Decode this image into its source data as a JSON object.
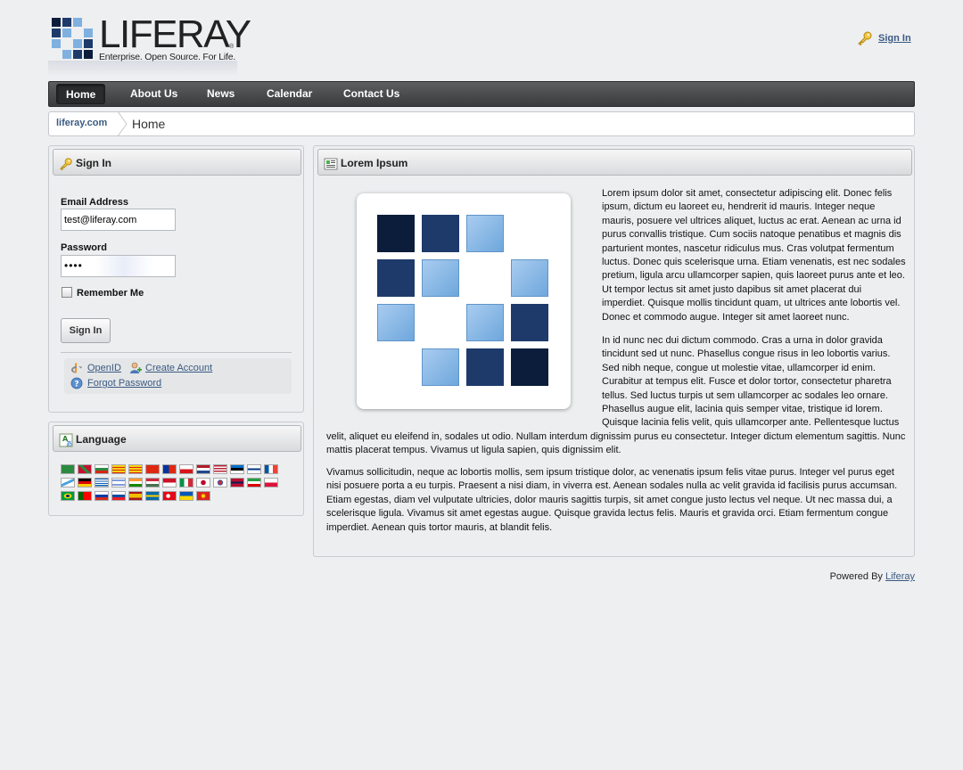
{
  "header": {
    "logo_text": "LIFERAY",
    "logo_reg": "®",
    "logo_tagline": "Enterprise. Open Source. For Life.",
    "sign_in_link": "Sign In"
  },
  "nav": {
    "items": [
      "Home",
      "About Us",
      "News",
      "Calendar",
      "Contact Us"
    ],
    "selected": "Home"
  },
  "breadcrumb": {
    "site": "liferay.com",
    "page": "Home"
  },
  "signin_portlet": {
    "title": "Sign In",
    "email_label": "Email Address",
    "email_value": "test@liferay.com",
    "password_label": "Password",
    "password_value": "••••",
    "remember_label": "Remember Me",
    "remember_checked": false,
    "submit_label": "Sign In",
    "openid_link": "OpenID",
    "create_account_link": "Create Account",
    "forgot_password_link": "Forgot Password"
  },
  "language_portlet": {
    "title": "Language",
    "flags": [
      "saudi-arabia-flag",
      "basque-flag",
      "bulgaria-flag",
      "catalonia-flag",
      "catalonia-flag",
      "china-flag",
      "taiwan-flag",
      "czech-flag",
      "netherlands-flag",
      "usa-flag",
      "estonia-flag",
      "finland-flag",
      "france-flag",
      "galicia-flag",
      "germany-flag",
      "greece-flag",
      "israel-flag",
      "india-flag",
      "hungary-flag",
      "indonesia-flag",
      "italy-flag",
      "japan-flag",
      "korea-flag",
      "norway-flag",
      "iran-flag",
      "poland-flag",
      "brazil-flag",
      "portugal-flag",
      "russia-flag",
      "slovakia-flag",
      "spain-flag",
      "sweden-flag",
      "turkey-flag",
      "ukraine-flag",
      "vietnam-flag"
    ]
  },
  "content_portlet": {
    "title": "Lorem Ipsum",
    "paragraphs": [
      "Lorem ipsum dolor sit amet, consectetur adipiscing elit. Donec felis ipsum, dictum eu laoreet eu, hendrerit id mauris. Integer neque mauris, posuere vel ultrices aliquet, luctus ac erat. Aenean ac urna id purus convallis tristique. Cum sociis natoque penatibus et magnis dis parturient montes, nascetur ridiculus mus. Cras volutpat fermentum luctus. Donec quis scelerisque urna. Etiam venenatis, est nec sodales pretium, ligula arcu ullamcorper sapien, quis laoreet purus ante et leo. Ut tempor lectus sit amet justo dapibus sit amet placerat dui imperdiet. Quisque mollis tincidunt quam, ut ultrices ante lobortis vel. Donec et commodo augue. Integer sit amet laoreet nunc.",
      "In id nunc nec dui dictum commodo. Cras a urna in dolor gravida tincidunt sed ut nunc. Phasellus congue risus in leo lobortis varius. Sed nibh neque, congue ut molestie vitae, ullamcorper id enim. Curabitur at tempus elit. Fusce et dolor tortor, consectetur pharetra tellus. Sed luctus turpis ut sem ullamcorper ac sodales leo ornare. Phasellus augue elit, lacinia quis semper vitae, tristique id lorem. Quisque lacinia felis velit, quis ullamcorper ante. Pellentesque luctus velit, aliquet eu eleifend in, sodales ut odio. Nullam interdum dignissim purus eu consectetur. Integer dictum elementum sagittis. Nunc mattis placerat tempus. Vivamus ut ligula sapien, quis dignissim elit.",
      "Vivamus sollicitudin, neque ac lobortis mollis, sem ipsum tristique dolor, ac venenatis ipsum felis vitae purus. Integer vel purus eget nisi posuere porta a eu turpis. Praesent a nisi diam, in viverra est. Aenean sodales nulla ac velit gravida id facilisis purus accumsan. Etiam egestas, diam vel vulputate ultricies, dolor mauris sagittis turpis, sit amet congue justo lectus vel neque. Ut nec massa dui, a scelerisque ligula. Vivamus sit amet egestas augue. Quisque gravida lectus felis. Mauris et gravida orci. Etiam fermentum congue imperdiet. Aenean quis tortor mauris, at blandit felis."
    ]
  },
  "footer": {
    "powered_by": "Powered By",
    "link": "Liferay"
  },
  "colors": {
    "link": "#3b5a82",
    "nav_bg": "#4a4b4d",
    "page_bg": "#eeeff1",
    "logo_dark_blue": "#1d3a6b",
    "logo_light_blue": "#7fb0e0"
  }
}
